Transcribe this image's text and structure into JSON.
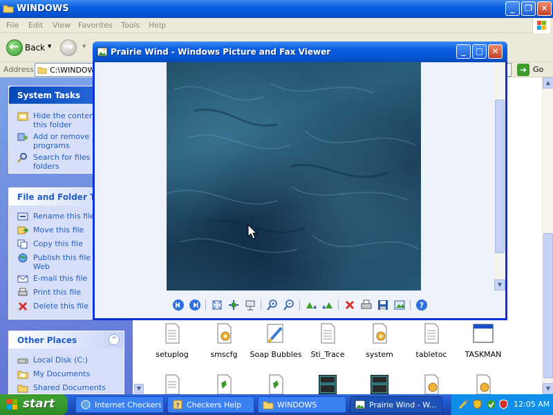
{
  "explorer": {
    "title": "WINDOWS",
    "menu": [
      "File",
      "Edit",
      "View",
      "Favorites",
      "Tools",
      "Help"
    ],
    "toolbar": {
      "back_label": "Back"
    },
    "address": {
      "label": "Address",
      "value": "C:\\WINDOWS",
      "go_label": "Go"
    },
    "system_tasks": {
      "title": "System Tasks",
      "items": [
        "Hide the contents of this folder",
        "Add or remove programs",
        "Search for files or folders"
      ]
    },
    "file_tasks": {
      "title": "File and Folder Tasks",
      "items": [
        "Rename this file",
        "Move this file",
        "Copy this file",
        "Publish this file to the Web",
        "E-mail this file",
        "Print this file",
        "Delete this file"
      ]
    },
    "other_places": {
      "title": "Other Places",
      "items": [
        "Local Disk (C:)",
        "My Documents",
        "Shared Documents"
      ]
    },
    "files": [
      {
        "name": "setuplog",
        "icon": "text-file-icon"
      },
      {
        "name": "smscfg",
        "icon": "config-file-icon"
      },
      {
        "name": "Soap Bubbles",
        "icon": "bitmap-brush-icon"
      },
      {
        "name": "Sti_Trace",
        "icon": "text-file-icon"
      },
      {
        "name": "system",
        "icon": "config-file-icon"
      },
      {
        "name": "tabletoc",
        "icon": "text-file-icon"
      },
      {
        "name": "TASKMAN",
        "icon": "application-window-icon"
      }
    ]
  },
  "viewer": {
    "title": "Prairie Wind - Windows Picture and Fax Viewer",
    "tools": [
      "previous-image-icon",
      "next-image-icon",
      "best-fit-icon",
      "actual-size-icon",
      "slideshow-icon",
      "zoom-in-icon",
      "zoom-out-icon",
      "rotate-clockwise-icon",
      "rotate-counterclockwise-icon",
      "delete-icon",
      "print-icon",
      "save-icon",
      "edit-icon",
      "help-icon"
    ]
  },
  "taskbar": {
    "start_label": "start",
    "buttons": [
      {
        "label": "Internet Checkers"
      },
      {
        "label": "Checkers Help"
      },
      {
        "label": "WINDOWS"
      },
      {
        "label": "Prairie Wind - W..."
      }
    ],
    "clock": "12:05 AM"
  },
  "colors": {
    "xp_blue": "#0553d3",
    "start_green": "#3c9b2a",
    "panel_text": "#215dc6"
  }
}
